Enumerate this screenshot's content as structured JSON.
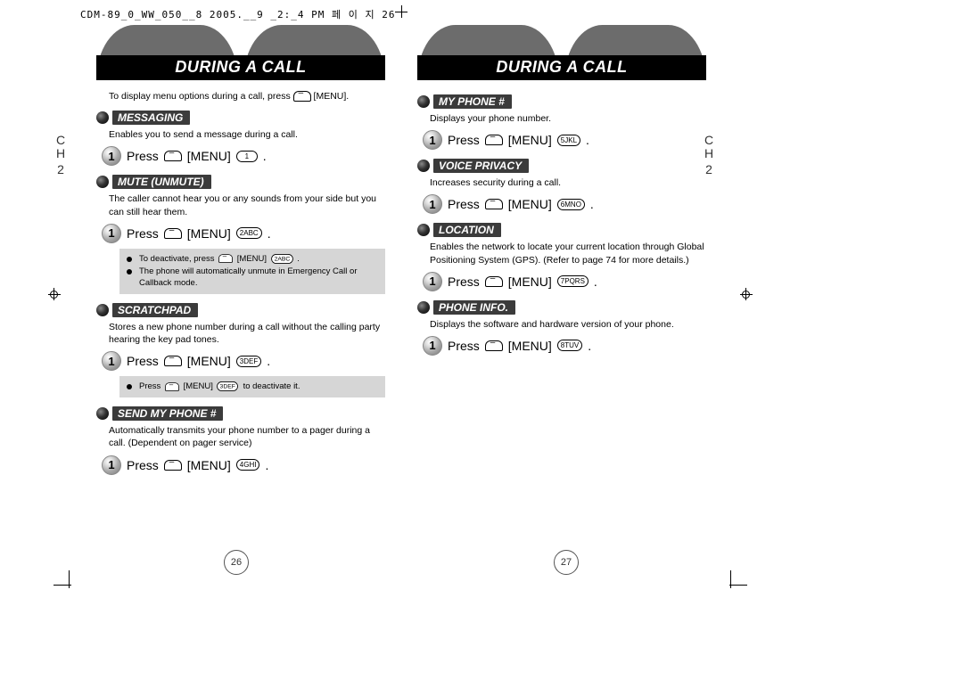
{
  "file_header": "CDM-89_0_WW_050__8 2005.__9 _2:_4 PM 페 이 지 26",
  "chapter": {
    "line1": "C",
    "line2": "H",
    "num": "2"
  },
  "page_numbers": {
    "left": "26",
    "right": "27"
  },
  "title": "DURING A CALL",
  "left_intro": "To display menu options during a call, press ",
  "left_intro_tail": " [MENU].",
  "sections_left": [
    {
      "name": "messaging",
      "label": "MESSAGING",
      "desc": "Enables you to send a message during a call.",
      "step_prefix": "Press ",
      "step_mid": " [MENU] ",
      "key": "1",
      "key_suffix": " .",
      "note": null
    },
    {
      "name": "mute",
      "label": "MUTE (UNMUTE)",
      "desc": "The caller cannot hear you or any sounds from your side but you can still hear them.",
      "step_prefix": "Press ",
      "step_mid": " [MENU] ",
      "key": "2ABC",
      "key_suffix": " .",
      "note": {
        "line1a": "To deactivate, press ",
        "line1b": " [MENU] ",
        "line1key": "2ABC",
        "line1c": " .",
        "line2": "The phone will automatically unmute in Emergency Call or Callback mode."
      }
    },
    {
      "name": "scratchpad",
      "label": "SCRATCHPAD",
      "desc": "Stores a new phone number during a call without the calling party hearing the key pad tones.",
      "step_prefix": "Press ",
      "step_mid": " [MENU] ",
      "key": "3DEF",
      "key_suffix": " .",
      "note": {
        "line1a": "Press ",
        "line1b": " [MENU] ",
        "line1key": "3DEF",
        "line1c": " to deactivate it.",
        "line2": null
      }
    },
    {
      "name": "send-my-phone",
      "label": "SEND MY PHONE #",
      "desc": "Automatically transmits your phone number to a pager during a call. (Dependent on pager service)",
      "step_prefix": "Press ",
      "step_mid": " [MENU] ",
      "key": "4GHI",
      "key_suffix": " .",
      "note": null
    }
  ],
  "sections_right": [
    {
      "name": "my-phone",
      "label": "MY PHONE #",
      "desc": "Displays your phone number.",
      "step_prefix": "Press ",
      "step_mid": " [MENU] ",
      "key": "5JKL",
      "key_suffix": " ."
    },
    {
      "name": "voice-privacy",
      "label": "VOICE PRIVACY",
      "desc": "Increases security during a call.",
      "step_prefix": "Press ",
      "step_mid": " [MENU] ",
      "key": "6MNO",
      "key_suffix": " ."
    },
    {
      "name": "location",
      "label": "LOCATION",
      "desc": "Enables the network to locate your current location through Global Positioning System (GPS). (Refer to page 74 for more details.)",
      "step_prefix": "Press ",
      "step_mid": " [MENU] ",
      "key": "7PQRS",
      "key_suffix": " ."
    },
    {
      "name": "phone-info",
      "label": "PHONE INFO.",
      "desc": "Displays the software and hardware version of your phone.",
      "step_prefix": "Press ",
      "step_mid": " [MENU] ",
      "key": "8TUV",
      "key_suffix": " ."
    }
  ]
}
